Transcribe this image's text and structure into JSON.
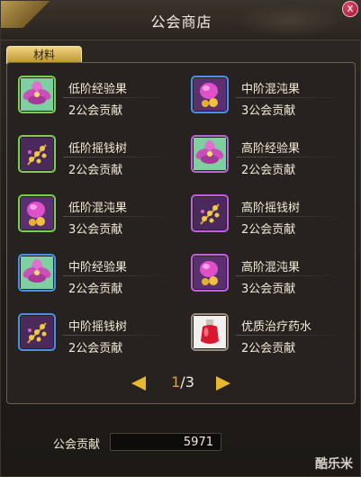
{
  "window": {
    "title": "公会商店",
    "close_label": "x"
  },
  "tabs": [
    {
      "label": "材料",
      "active": true
    }
  ],
  "items": [
    {
      "name": "低阶经验果",
      "cost": "2公会贡献",
      "icon": "lotus-flower-icon",
      "rarity": "green"
    },
    {
      "name": "中阶混沌果",
      "cost": "3公会贡献",
      "icon": "chaos-fruit-icon",
      "rarity": "blue"
    },
    {
      "name": "低阶摇钱树",
      "cost": "2公会贡献",
      "icon": "money-tree-icon",
      "rarity": "green"
    },
    {
      "name": "高阶经验果",
      "cost": "2公会贡献",
      "icon": "lotus-flower-icon",
      "rarity": "purple"
    },
    {
      "name": "低阶混沌果",
      "cost": "3公会贡献",
      "icon": "chaos-fruit-icon",
      "rarity": "green"
    },
    {
      "name": "高阶摇钱树",
      "cost": "2公会贡献",
      "icon": "money-tree-icon",
      "rarity": "purple"
    },
    {
      "name": "中阶经验果",
      "cost": "2公会贡献",
      "icon": "lotus-flower-icon",
      "rarity": "blue"
    },
    {
      "name": "高阶混沌果",
      "cost": "3公会贡献",
      "icon": "chaos-fruit-icon",
      "rarity": "purple"
    },
    {
      "name": "中阶摇钱树",
      "cost": "2公会贡献",
      "icon": "money-tree-icon",
      "rarity": "blue"
    },
    {
      "name": "优质治疗药水",
      "cost": "2公会贡献",
      "icon": "healing-potion-icon",
      "rarity": "red"
    }
  ],
  "pager": {
    "current": "1",
    "total": "/3"
  },
  "footer": {
    "contribution_label": "公会贡献",
    "contribution_value": "5971"
  },
  "watermark": "酷乐米",
  "colors": {
    "tab_gold": "#d8b040",
    "arrow_gold": "#e8b82c",
    "page_current": "#e89a3c"
  }
}
